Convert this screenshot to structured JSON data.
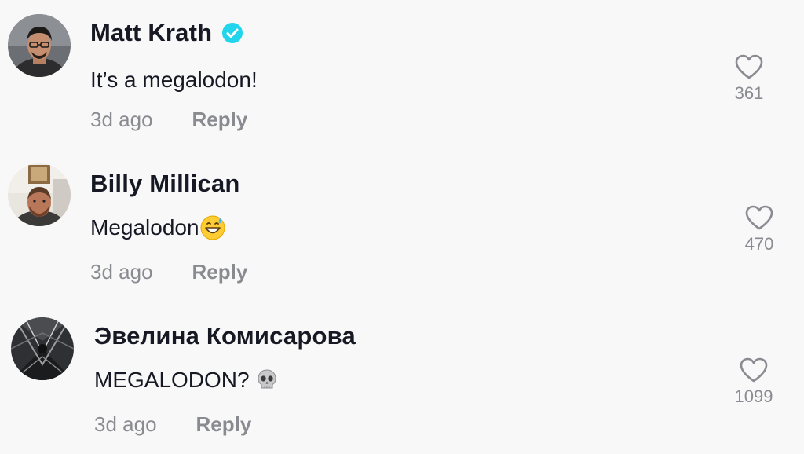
{
  "comments": [
    {
      "username": "Matt Krath",
      "verified": true,
      "text": "It’s a megalodon!",
      "time": "3d ago",
      "reply_label": "Reply",
      "likes": "361",
      "like_icon": "heart-outline-icon"
    },
    {
      "username": "Billy Millican",
      "verified": false,
      "text": "Megalodon",
      "emoji": "grinning-face-with-sweat-icon",
      "time": "3d ago",
      "reply_label": "Reply",
      "likes": "470",
      "like_icon": "heart-outline-icon"
    },
    {
      "username": "Эвелина Комисарова",
      "verified": false,
      "text": "MEGALODON? ",
      "emoji": "skull-icon",
      "time": "3d ago",
      "reply_label": "Reply",
      "likes": "1099",
      "like_icon": "heart-outline-icon"
    }
  ],
  "colors": {
    "background": "#f8f8f8",
    "text": "#161823",
    "secondary_text": "#8a8b91",
    "verified_badge": "#20d5ec",
    "heart_outline": "#8a8b91"
  }
}
